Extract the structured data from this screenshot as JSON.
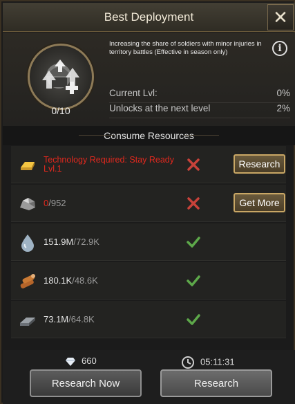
{
  "header": {
    "title": "Best Deployment",
    "close_icon": "close-icon"
  },
  "tech": {
    "icon": "soldier-upgrade-icon",
    "level": "0/10",
    "description": "Increasing the share of soldiers with minor injuries in territory battles (Effective in season only)",
    "stats": [
      {
        "label": "Current Lvl:",
        "value": "0%"
      },
      {
        "label": "Unlocks at the next level",
        "value": "2%"
      }
    ]
  },
  "section": {
    "title": "Consume Resources"
  },
  "resources": [
    {
      "icon": "gold-bar-icon",
      "text": "Technology Required: Stay Ready Lvl.1",
      "status": "cross-icon",
      "button": "Research"
    },
    {
      "icon": "ore-icon",
      "have": "0",
      "need": "/952",
      "status": "cross-icon",
      "button": "Get More"
    },
    {
      "icon": "oil-drop-icon",
      "have": "151.9M",
      "need": "/72.9K",
      "status": "check-icon"
    },
    {
      "icon": "wood-logs-icon",
      "have": "180.1K",
      "need": "/48.6K",
      "status": "check-icon"
    },
    {
      "icon": "steel-bar-icon",
      "have": "73.1M",
      "need": "/64.8K",
      "status": "check-icon"
    }
  ],
  "footer": {
    "gems": "660",
    "time": "05:11:31",
    "research_now": "Research Now",
    "research": "Research"
  },
  "colors": {
    "accent_gold": "#c9a765",
    "danger": "#e0281e",
    "ok": "#5da84a"
  }
}
